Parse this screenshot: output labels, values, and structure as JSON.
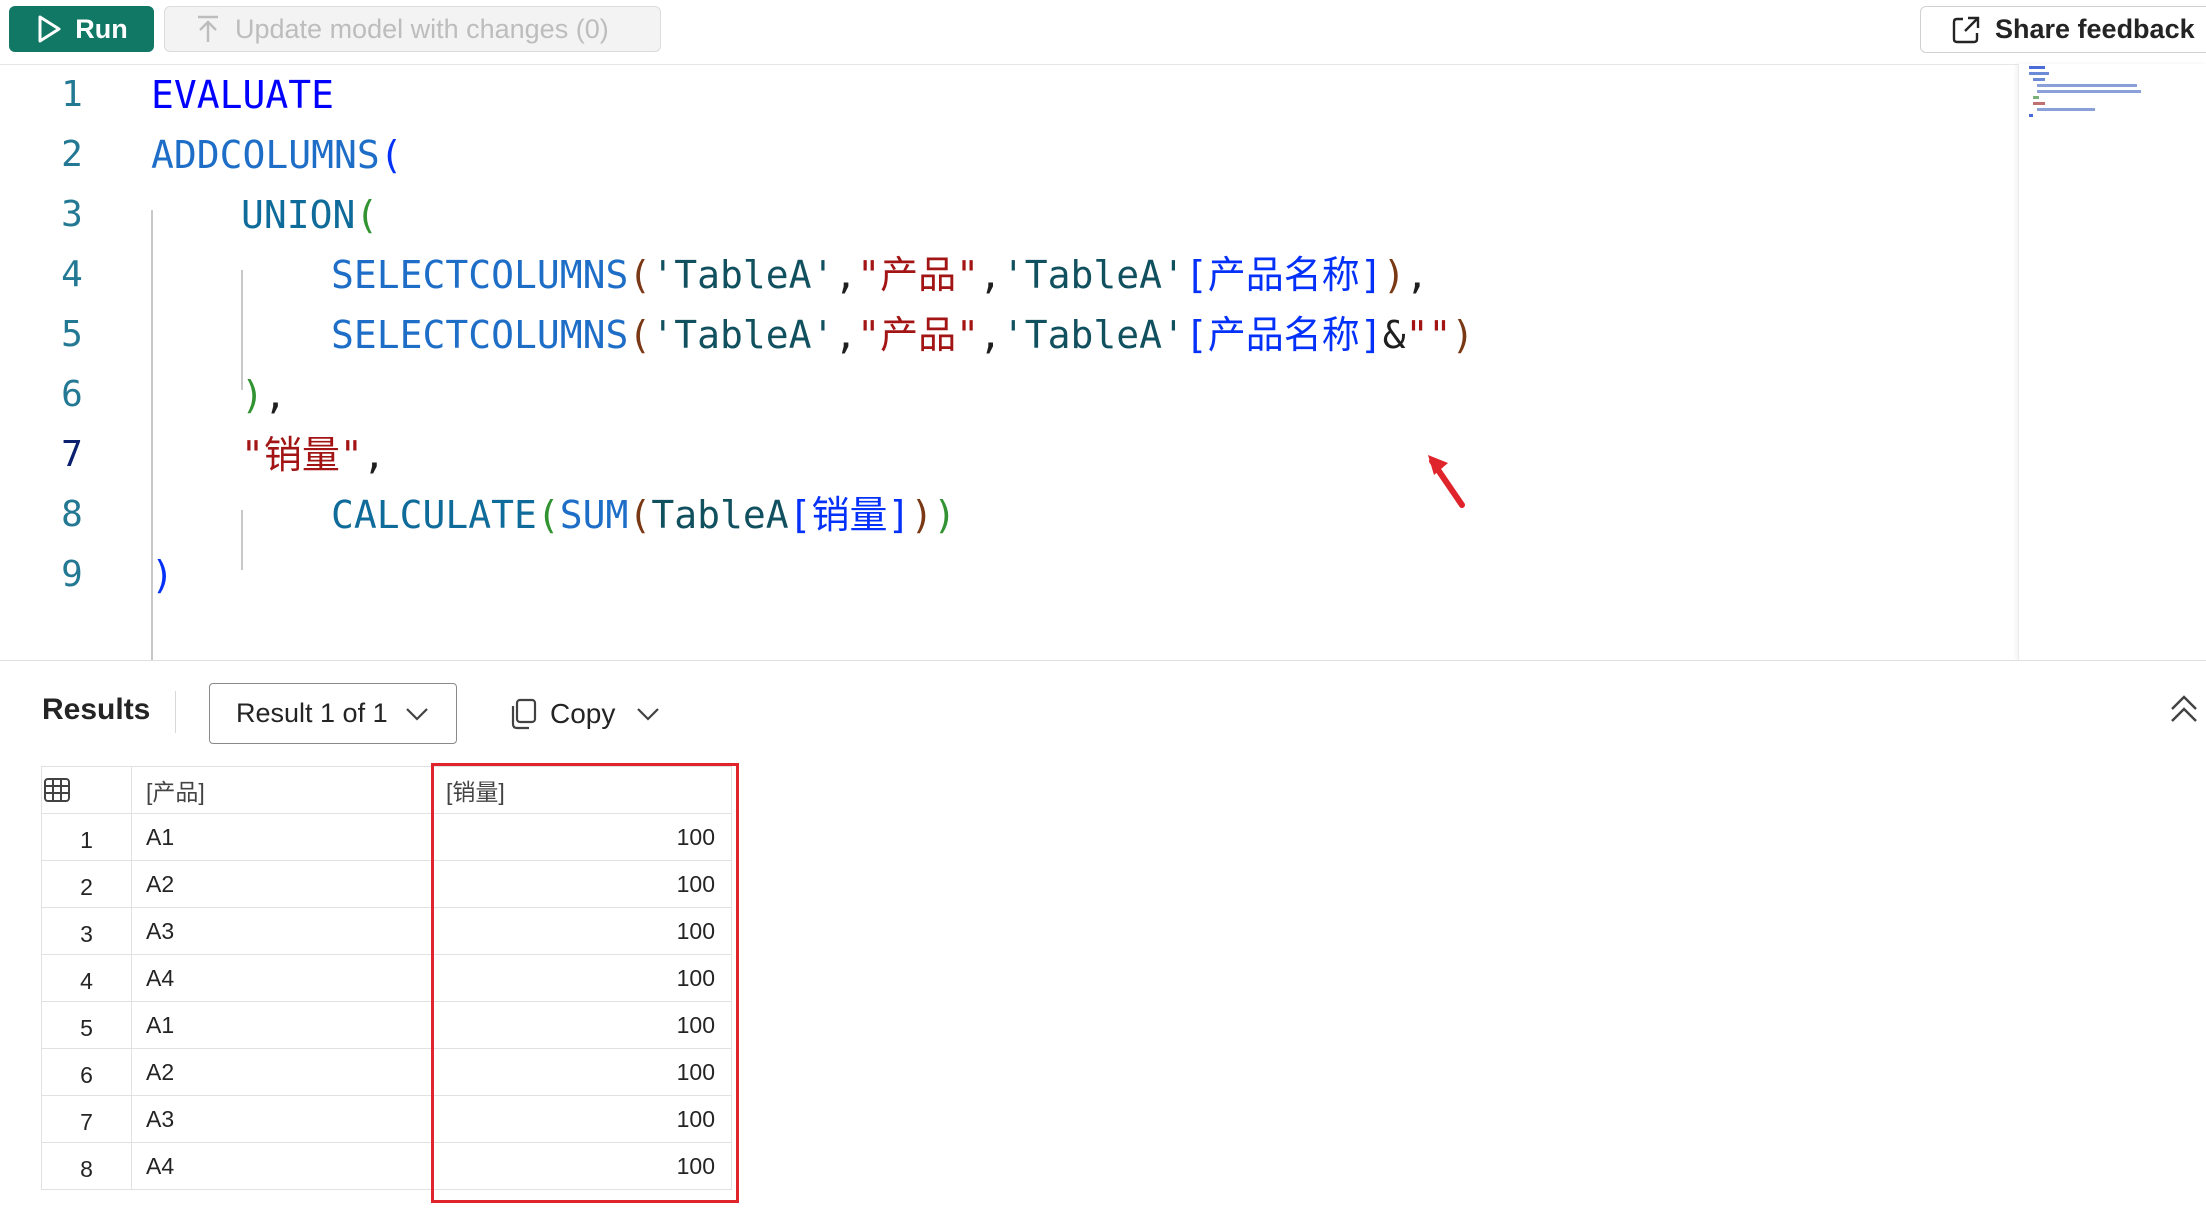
{
  "toolbar": {
    "run_label": "Run",
    "update_label": "Update model with changes (0)",
    "feedback_label": "Share feedback"
  },
  "editor": {
    "line_numbers": [
      "1",
      "2",
      "3",
      "4",
      "5",
      "6",
      "7",
      "8",
      "9"
    ],
    "active_line": "7",
    "lines": [
      [
        {
          "t": "EVALUATE",
          "c": "kw"
        }
      ],
      [
        {
          "t": "ADDCOLUMNS",
          "c": "fn"
        },
        {
          "t": "(",
          "c": "p1"
        }
      ],
      [
        {
          "t": "UNION",
          "c": "fn2"
        },
        {
          "t": "(",
          "c": "p2"
        }
      ],
      [
        {
          "t": "SELECTCOLUMNS",
          "c": "fn"
        },
        {
          "t": "(",
          "c": "p3"
        },
        {
          "t": "'TableA'",
          "c": "tbl"
        },
        {
          "t": ",",
          "c": "plain"
        },
        {
          "t": "\"产品\"",
          "c": "str"
        },
        {
          "t": ",",
          "c": "plain"
        },
        {
          "t": "'TableA'",
          "c": "tbl"
        },
        {
          "t": "[产品名称]",
          "c": "p1"
        },
        {
          "t": ")",
          "c": "p3"
        },
        {
          "t": ",",
          "c": "plain"
        }
      ],
      [
        {
          "t": "SELECTCOLUMNS",
          "c": "fn"
        },
        {
          "t": "(",
          "c": "p3"
        },
        {
          "t": "'TableA'",
          "c": "tbl"
        },
        {
          "t": ",",
          "c": "plain"
        },
        {
          "t": "\"产品\"",
          "c": "str"
        },
        {
          "t": ",",
          "c": "plain"
        },
        {
          "t": "'TableA'",
          "c": "tbl"
        },
        {
          "t": "[产品名称]",
          "c": "p1"
        },
        {
          "t": "&",
          "c": "plain"
        },
        {
          "t": "\"\"",
          "c": "str"
        },
        {
          "t": ")",
          "c": "p3"
        }
      ],
      [
        {
          "t": ")",
          "c": "p2"
        },
        {
          "t": ",",
          "c": "plain"
        }
      ],
      [
        {
          "t": "\"销量\"",
          "c": "str"
        },
        {
          "t": ",",
          "c": "plain"
        }
      ],
      [
        {
          "t": "CALCULATE",
          "c": "fn2"
        },
        {
          "t": "(",
          "c": "p2"
        },
        {
          "t": "SUM",
          "c": "fn"
        },
        {
          "t": "(",
          "c": "p3"
        },
        {
          "t": "TableA",
          "c": "tbl"
        },
        {
          "t": "[销量]",
          "c": "p1"
        },
        {
          "t": ")",
          "c": "p3"
        },
        {
          "t": ")",
          "c": "p2"
        }
      ],
      [
        {
          "t": ")",
          "c": "p1"
        }
      ]
    ]
  },
  "results": {
    "title": "Results",
    "selector_label": "Result 1 of 1",
    "copy_label": "Copy",
    "columns": [
      "[产品]",
      "[销量]"
    ],
    "rows": [
      {
        "idx": "1",
        "product": "A1",
        "sales": "100"
      },
      {
        "idx": "2",
        "product": "A2",
        "sales": "100"
      },
      {
        "idx": "3",
        "product": "A3",
        "sales": "100"
      },
      {
        "idx": "4",
        "product": "A4",
        "sales": "100"
      },
      {
        "idx": "5",
        "product": "A1",
        "sales": "100"
      },
      {
        "idx": "6",
        "product": "A2",
        "sales": "100"
      },
      {
        "idx": "7",
        "product": "A3",
        "sales": "100"
      },
      {
        "idx": "8",
        "product": "A4",
        "sales": "100"
      }
    ]
  },
  "colors": {
    "run_button": "#117865",
    "highlight_box": "#e0242b",
    "annotation_arrow": "#e0242b"
  }
}
